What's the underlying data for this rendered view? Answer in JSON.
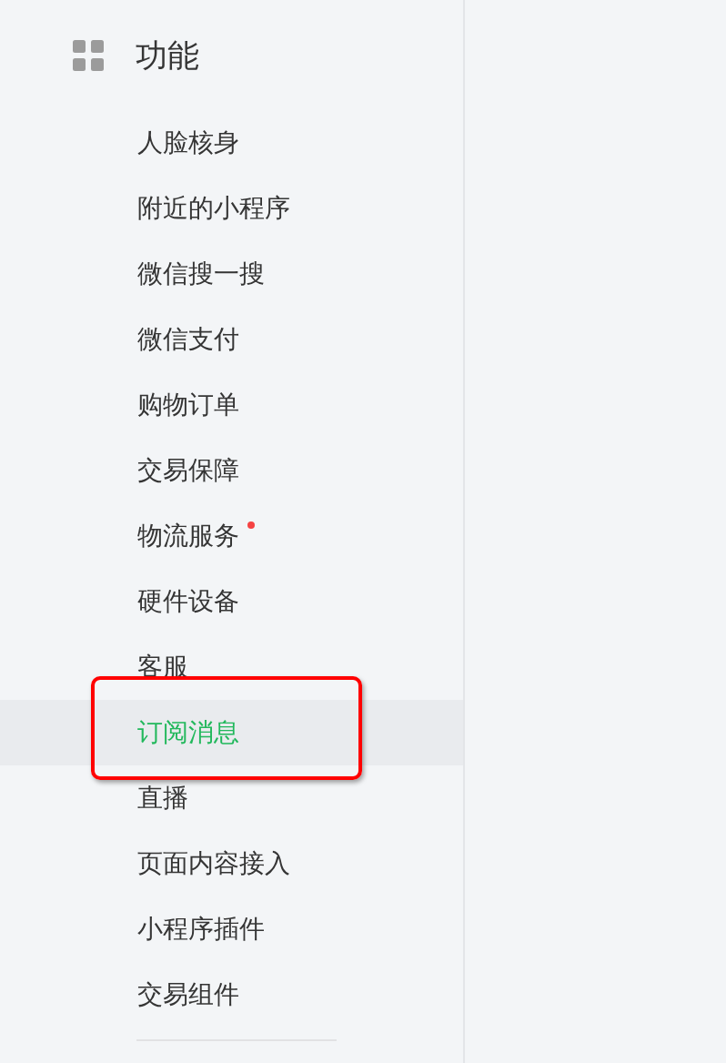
{
  "sidebar": {
    "header": {
      "title": "功能"
    },
    "items": [
      {
        "label": "人脸核身",
        "selected": false,
        "dot": false,
        "annotated": false
      },
      {
        "label": "附近的小程序",
        "selected": false,
        "dot": false,
        "annotated": false
      },
      {
        "label": "微信搜一搜",
        "selected": false,
        "dot": false,
        "annotated": false
      },
      {
        "label": "微信支付",
        "selected": false,
        "dot": false,
        "annotated": false
      },
      {
        "label": "购物订单",
        "selected": false,
        "dot": false,
        "annotated": false
      },
      {
        "label": "交易保障",
        "selected": false,
        "dot": false,
        "annotated": false
      },
      {
        "label": "物流服务",
        "selected": false,
        "dot": true,
        "annotated": false
      },
      {
        "label": "硬件设备",
        "selected": false,
        "dot": false,
        "annotated": false
      },
      {
        "label": "客服",
        "selected": false,
        "dot": false,
        "annotated": false
      },
      {
        "label": "订阅消息",
        "selected": true,
        "dot": false,
        "annotated": true
      },
      {
        "label": "直播",
        "selected": false,
        "dot": false,
        "annotated": false
      },
      {
        "label": "页面内容接入",
        "selected": false,
        "dot": false,
        "annotated": false
      },
      {
        "label": "小程序插件",
        "selected": false,
        "dot": false,
        "annotated": false
      },
      {
        "label": "交易组件",
        "selected": false,
        "dot": false,
        "annotated": false
      }
    ]
  }
}
